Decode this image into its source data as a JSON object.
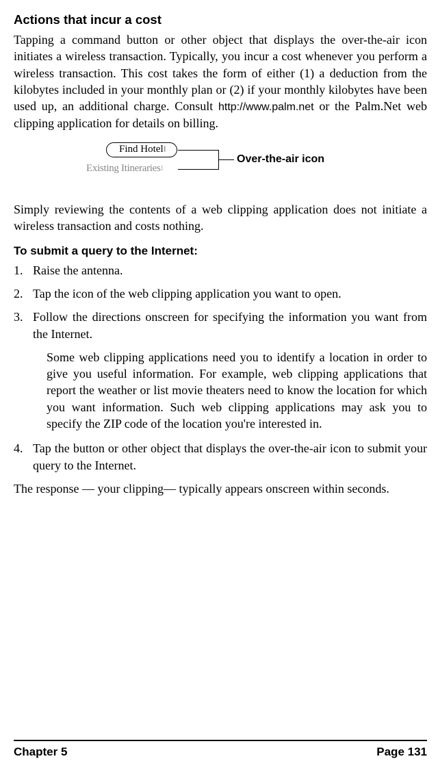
{
  "heading": "Actions that incur a cost",
  "para1_part1": "Tapping a command button or other object that displays the over-the-air icon initiates a wireless transaction. Typically, you incur a cost whenever you perform a wireless transaction. This cost takes the form of either (1) a deduction from the kilobytes included in your monthly plan or (2) if your monthly kilobytes have been used up, an additional charge. Consult ",
  "para1_url": "http://www.palm.net",
  "para1_part2": " or the Palm.Net web clipping application for details on billing.",
  "figure": {
    "button_label": "Find Hotel",
    "gray_label": "Existing Itineraries",
    "callout": "Over-the-air icon"
  },
  "para2": "Simply reviewing the contents of a web clipping application does not initiate a wireless transaction and costs nothing.",
  "sub_heading": "To submit a query to the Internet:",
  "steps": [
    {
      "num": "1.",
      "text": "Raise the antenna."
    },
    {
      "num": "2.",
      "text": "Tap the icon of the web clipping application you want to open."
    },
    {
      "num": "3.",
      "text": "Follow the directions onscreen for specifying the information you want from the Internet."
    }
  ],
  "step3_sub": "Some web clipping applications need you to identify a location in order to give you useful information. For example, web clipping applications that report the weather or list movie theaters need to know the location for which you want information. Such web clipping applications may ask you to specify the ZIP code of the location you're interested in.",
  "step4": {
    "num": "4.",
    "text": "Tap the button or other object that displays the over-the-air icon to submit your query to the Internet."
  },
  "para3": "The response — your clipping— typically appears onscreen within seconds.",
  "footer": {
    "left": "Chapter 5",
    "right": "Page 131"
  }
}
